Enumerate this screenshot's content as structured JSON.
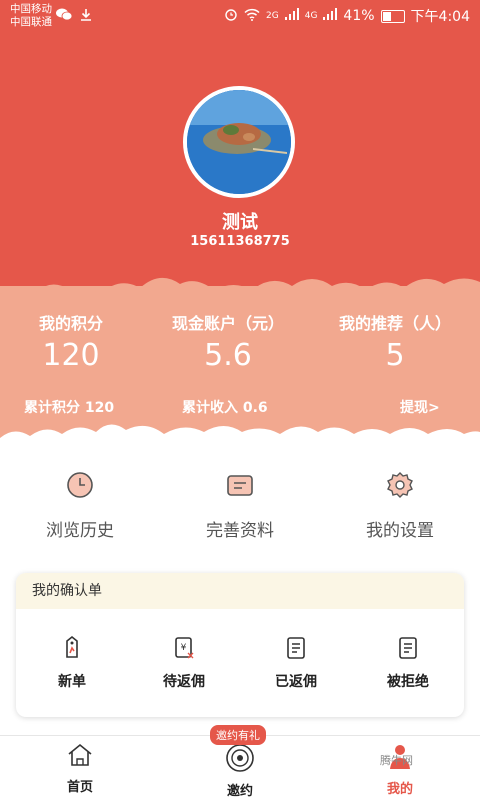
{
  "status_bar": {
    "carrier_1": "中国移动",
    "carrier_2": "中国联通",
    "signal_1": "2G",
    "signal_2": "4G",
    "battery": "41%",
    "time": "下午4:04"
  },
  "profile": {
    "name": "测试",
    "phone": "15611368775"
  },
  "stats": [
    {
      "label": "我的积分",
      "value": "120"
    },
    {
      "label": "现金账户（元）",
      "value": "5.6"
    },
    {
      "label": "我的推荐（人）",
      "value": "5"
    }
  ],
  "stats_sub": {
    "total_points": "累计积分 120",
    "total_income": "累计收入 0.6",
    "withdraw": "提现>"
  },
  "quick_actions": [
    {
      "label": "浏览历史",
      "icon": "clock-icon"
    },
    {
      "label": "完善资料",
      "icon": "profile-card-icon"
    },
    {
      "label": "我的设置",
      "icon": "gear-icon"
    }
  ],
  "orders": {
    "title": "我的确认单",
    "items": [
      {
        "label": "新单",
        "icon": "new-tag-icon"
      },
      {
        "label": "待返佣",
        "icon": "pending-refund-icon"
      },
      {
        "label": "已返佣",
        "icon": "refunded-doc-icon"
      },
      {
        "label": "被拒绝",
        "icon": "rejected-doc-icon"
      }
    ]
  },
  "nav": {
    "badge": "邀约有礼",
    "items": [
      {
        "label": "首页",
        "icon": "home-icon"
      },
      {
        "label": "邀约",
        "icon": "invite-signal-icon"
      },
      {
        "label": "我的",
        "icon": "person-icon"
      }
    ]
  },
  "watermark": "腾牛网",
  "colors": {
    "header": "#e5574a",
    "stats_bg": "#f2a88f",
    "card_header": "#fbf6e5"
  }
}
